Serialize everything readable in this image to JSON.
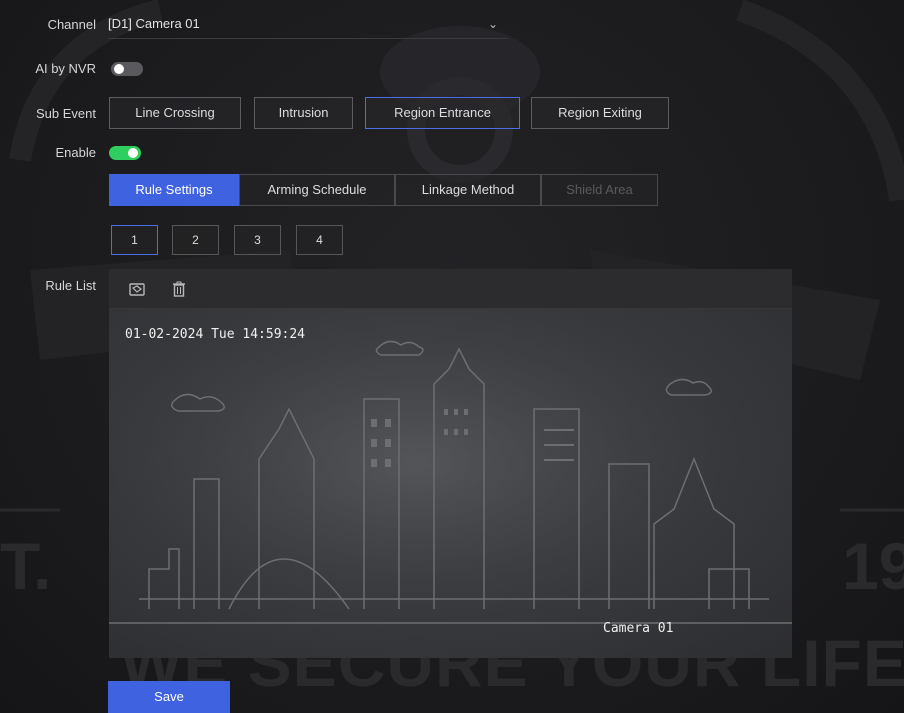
{
  "form": {
    "channel_label": "Channel",
    "channel_value": "[D1] Camera 01",
    "ai_by_nvr_label": "AI by NVR",
    "ai_by_nvr_on": false,
    "sub_event_label": "Sub Event",
    "sub_events": [
      "Line Crossing",
      "Intrusion",
      "Region Entrance",
      "Region Exiting"
    ],
    "selected_sub_event": "Region Entrance",
    "enable_label": "Enable",
    "enable_on": true,
    "rule_list_label": "Rule List"
  },
  "tabs": [
    "Rule Settings",
    "Arming Schedule",
    "Linkage Method",
    "Shield Area"
  ],
  "active_tab": "Rule Settings",
  "disabled_tab": "Shield Area",
  "rule_numbers": [
    "1",
    "2",
    "3",
    "4"
  ],
  "active_rule": "1",
  "toolbar_icons": [
    "draw-region-icon",
    "delete-icon"
  ],
  "preview": {
    "timestamp": "01-02-2024 Tue 14:59:24",
    "camera_name": "Camera 01"
  },
  "save_label": "Save",
  "watermark": {
    "slogan": "WE SECURE YOUR LIFE",
    "left_fragment": "T.",
    "right_fragment": "19"
  },
  "colors": {
    "accent": "#3f63e0",
    "toggle_on": "#2fcf5f",
    "toggle_off": "#5a5a5e",
    "background": "#1b1b1d"
  }
}
